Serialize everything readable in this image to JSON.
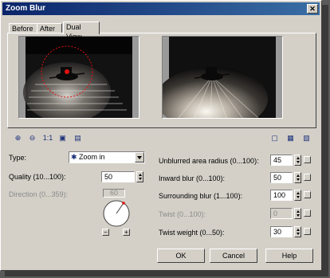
{
  "window": {
    "title": "Zoom Blur",
    "close_glyph": "✕"
  },
  "tabs": [
    {
      "label": "Before"
    },
    {
      "label": "After"
    },
    {
      "label": "Dual View",
      "active": true
    }
  ],
  "toolbar": {
    "zoom_in_icon": "⊕",
    "zoom_out_icon": "⊖",
    "actual_size_label": "1:1",
    "fit_icon": "▣",
    "preview_icon": "▤",
    "right_icons": [
      "▢",
      "▦",
      "▧"
    ]
  },
  "controls": {
    "type": {
      "label": "Type:",
      "value": "Zoom in",
      "icon": "✱"
    },
    "quality": {
      "label": "Quality (10...100):",
      "value": "50"
    },
    "direction": {
      "label": "Direction (0...359):",
      "value": "60",
      "enabled": false
    },
    "unblurred_radius": {
      "label": "Unblurred area radius (0...100):",
      "value": "45"
    },
    "inward_blur": {
      "label": "Inward blur (0...100):",
      "value": "50"
    },
    "surrounding_blur": {
      "label": "Surrounding blur (1...100):",
      "value": "100"
    },
    "twist": {
      "label": "Twist (0...100):",
      "value": "0",
      "enabled": false
    },
    "twist_weight": {
      "label": "Twist weight (0...50):",
      "value": "30"
    },
    "dial_minus": "−",
    "dial_plus": "+"
  },
  "buttons": {
    "ok": "OK",
    "cancel": "Cancel",
    "help": "Help"
  },
  "colors": {
    "title_start": "#0a246a",
    "title_end": "#3a6ea5",
    "marker": "#e01010"
  }
}
